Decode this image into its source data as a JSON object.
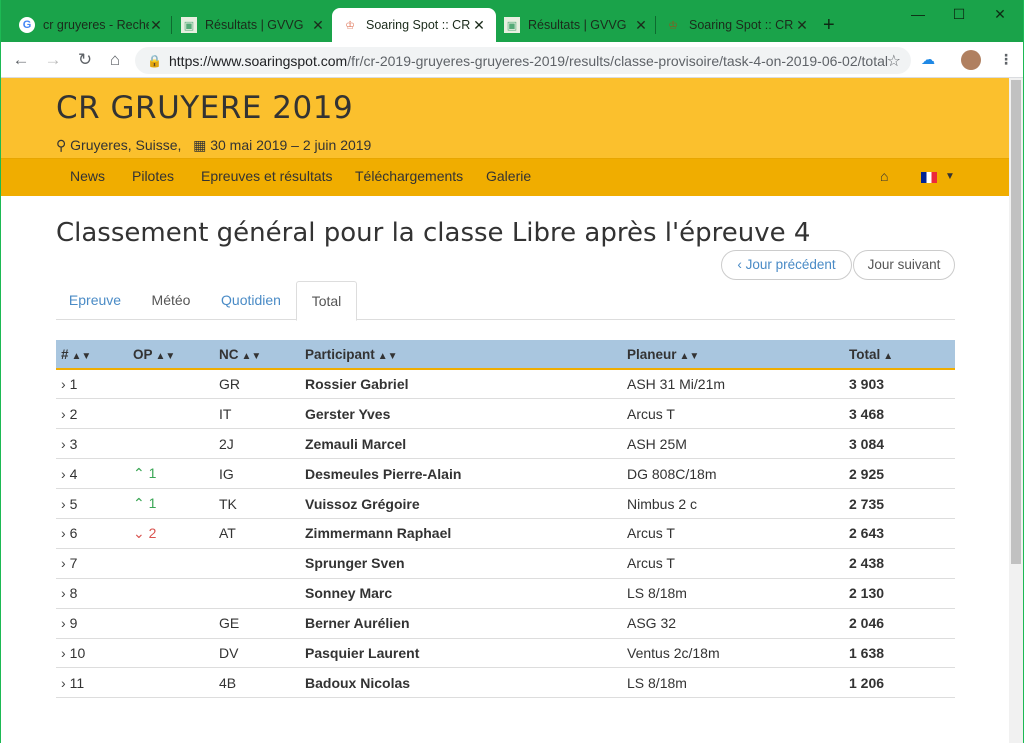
{
  "browser": {
    "tabs": [
      {
        "title": "cr gruyeres - Recherc",
        "fav": "G",
        "active": false
      },
      {
        "title": "Résultats | GVVG",
        "fav": "▣",
        "active": false
      },
      {
        "title": "Soaring Spot :: CR G",
        "fav": "♔",
        "active": true
      },
      {
        "title": "Résultats | GVVG",
        "fav": "▣",
        "active": false
      },
      {
        "title": "Soaring Spot :: CR G",
        "fav": "♔",
        "active": false
      }
    ],
    "url_host": "https://www.soaringspot.com",
    "url_path": "/fr/cr-2019-gruyeres-gruyeres-2019/results/classe-provisoire/task-4-on-2019-06-02/total",
    "icons": [
      "back-icon",
      "forward-icon",
      "reload-icon",
      "home-icon",
      "lock-icon",
      "star-icon",
      "cloud-icon",
      "avatar",
      "menu-icon"
    ]
  },
  "site": {
    "title": "CR GRUYERE 2019",
    "location": "Gruyeres, Suisse,",
    "dates": "30 mai 2019 – 2 juin 2019",
    "nav": [
      "News",
      "Pilotes",
      "Epreuves et résultats",
      "Téléchargements",
      "Galerie"
    ]
  },
  "main": {
    "heading": "Classement général pour la classe Libre après l'épreuve 4",
    "prev_label": "Jour précédent",
    "next_label": "Jour suivant",
    "tabs": [
      "Epreuve",
      "Météo",
      "Quotidien",
      "Total"
    ],
    "active_tab": "Total",
    "columns": [
      "#",
      "OP",
      "NC",
      "Participant",
      "Planeur",
      "Total"
    ],
    "rows": [
      {
        "rank": "1",
        "op": "",
        "op_dir": "",
        "nc": "GR",
        "name": "Rossier Gabriel",
        "glider": "ASH 31 Mi/21m",
        "total": "3 903"
      },
      {
        "rank": "2",
        "op": "",
        "op_dir": "",
        "nc": "IT",
        "name": "Gerster Yves",
        "glider": "Arcus T",
        "total": "3 468"
      },
      {
        "rank": "3",
        "op": "",
        "op_dir": "",
        "nc": "2J",
        "name": "Zemauli Marcel",
        "glider": "ASH 25M",
        "total": "3 084"
      },
      {
        "rank": "4",
        "op": "1",
        "op_dir": "up",
        "nc": "IG",
        "name": "Desmeules Pierre-Alain",
        "glider": "DG 808C/18m",
        "total": "2 925"
      },
      {
        "rank": "5",
        "op": "1",
        "op_dir": "up",
        "nc": "TK",
        "name": "Vuissoz Grégoire",
        "glider": "Nimbus 2 c",
        "total": "2 735"
      },
      {
        "rank": "6",
        "op": "2",
        "op_dir": "down",
        "nc": "AT",
        "name": "Zimmermann Raphael",
        "glider": "Arcus T",
        "total": "2 643"
      },
      {
        "rank": "7",
        "op": "",
        "op_dir": "",
        "nc": "",
        "name": "Sprunger Sven",
        "glider": "Arcus T",
        "total": "2 438"
      },
      {
        "rank": "8",
        "op": "",
        "op_dir": "",
        "nc": "",
        "name": "Sonney Marc",
        "glider": "LS 8/18m",
        "total": "2 130"
      },
      {
        "rank": "9",
        "op": "",
        "op_dir": "",
        "nc": "GE",
        "name": "Berner Aurélien",
        "glider": "ASG 32",
        "total": "2 046"
      },
      {
        "rank": "10",
        "op": "",
        "op_dir": "",
        "nc": "DV",
        "name": "Pasquier Laurent",
        "glider": "Ventus 2c/18m",
        "total": "1 638"
      },
      {
        "rank": "11",
        "op": "",
        "op_dir": "",
        "nc": "4B",
        "name": "Badoux Nicolas",
        "glider": "LS 8/18m",
        "total": "1 206"
      }
    ]
  },
  "colors": {
    "header": "#fbc02d",
    "navbar": "#f0ad00",
    "table_head": "#a9c6df",
    "chrome": "#1aa34a"
  }
}
